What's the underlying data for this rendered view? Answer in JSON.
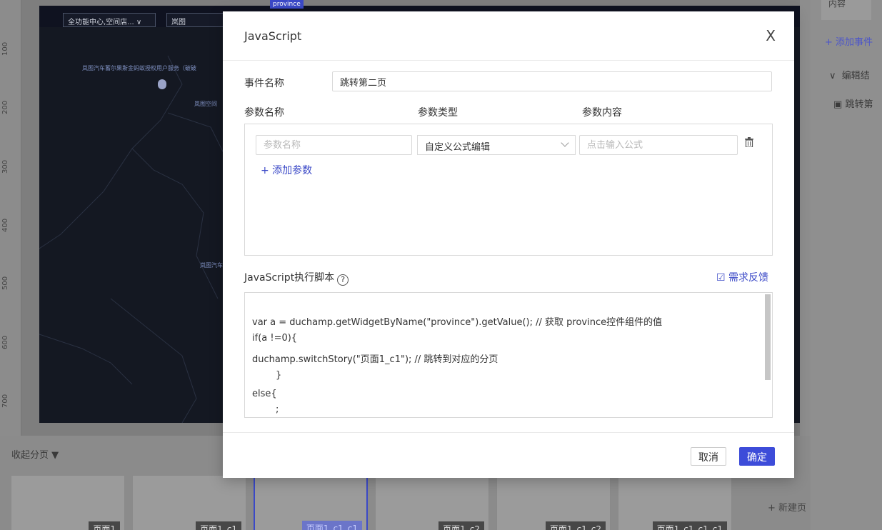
{
  "background": {
    "ruler_ticks": [
      "100",
      "200",
      "300",
      "400",
      "500",
      "600",
      "700"
    ],
    "map_select_1": "全功能中心,空间店...",
    "map_select_2": "岚图",
    "province_tab": "province",
    "map_labels": [
      "岚图汽车蓄尔果斯金蚂蚁授权用户服务（破破",
      "岚图空间",
      "岚图汽车"
    ],
    "right_panel": {
      "tab": "内容",
      "add_event": "+ 添加事件",
      "edit": "编辑结",
      "item": "跳转第"
    },
    "collapse_pages": "收起分页",
    "new_page": "+ 新建页",
    "thumbs": [
      "页面1",
      "页面1_c1",
      "页面1_c1_c1",
      "页面1_c2",
      "页面1_c1_c2",
      "页面1_c1_c1_c1"
    ]
  },
  "modal": {
    "title": "JavaScript",
    "close": "X",
    "event_name_label": "事件名称",
    "event_name_value": "跳转第二页",
    "param_name_header": "参数名称",
    "param_type_header": "参数类型",
    "param_content_header": "参数内容",
    "param_name_placeholder": "参数名称",
    "param_type_value": "自定义公式编辑",
    "param_content_placeholder": "点击输入公式",
    "add_param": "+ 添加参数",
    "js_label": "JavaScript执行脚本",
    "help": "?",
    "feedback": "需求反馈",
    "code_lines": [
      "var a = duchamp.getWidgetByName(\"province\").getValue(); // 获取 province控件组件的值",
      "if(a !=0){",
      "duchamp.switchStory(\"页面1_c1\"); // 跳转到对应的分页",
      "        }",
      "else{",
      "        ;"
    ],
    "cancel": "取消",
    "ok": "确定"
  }
}
